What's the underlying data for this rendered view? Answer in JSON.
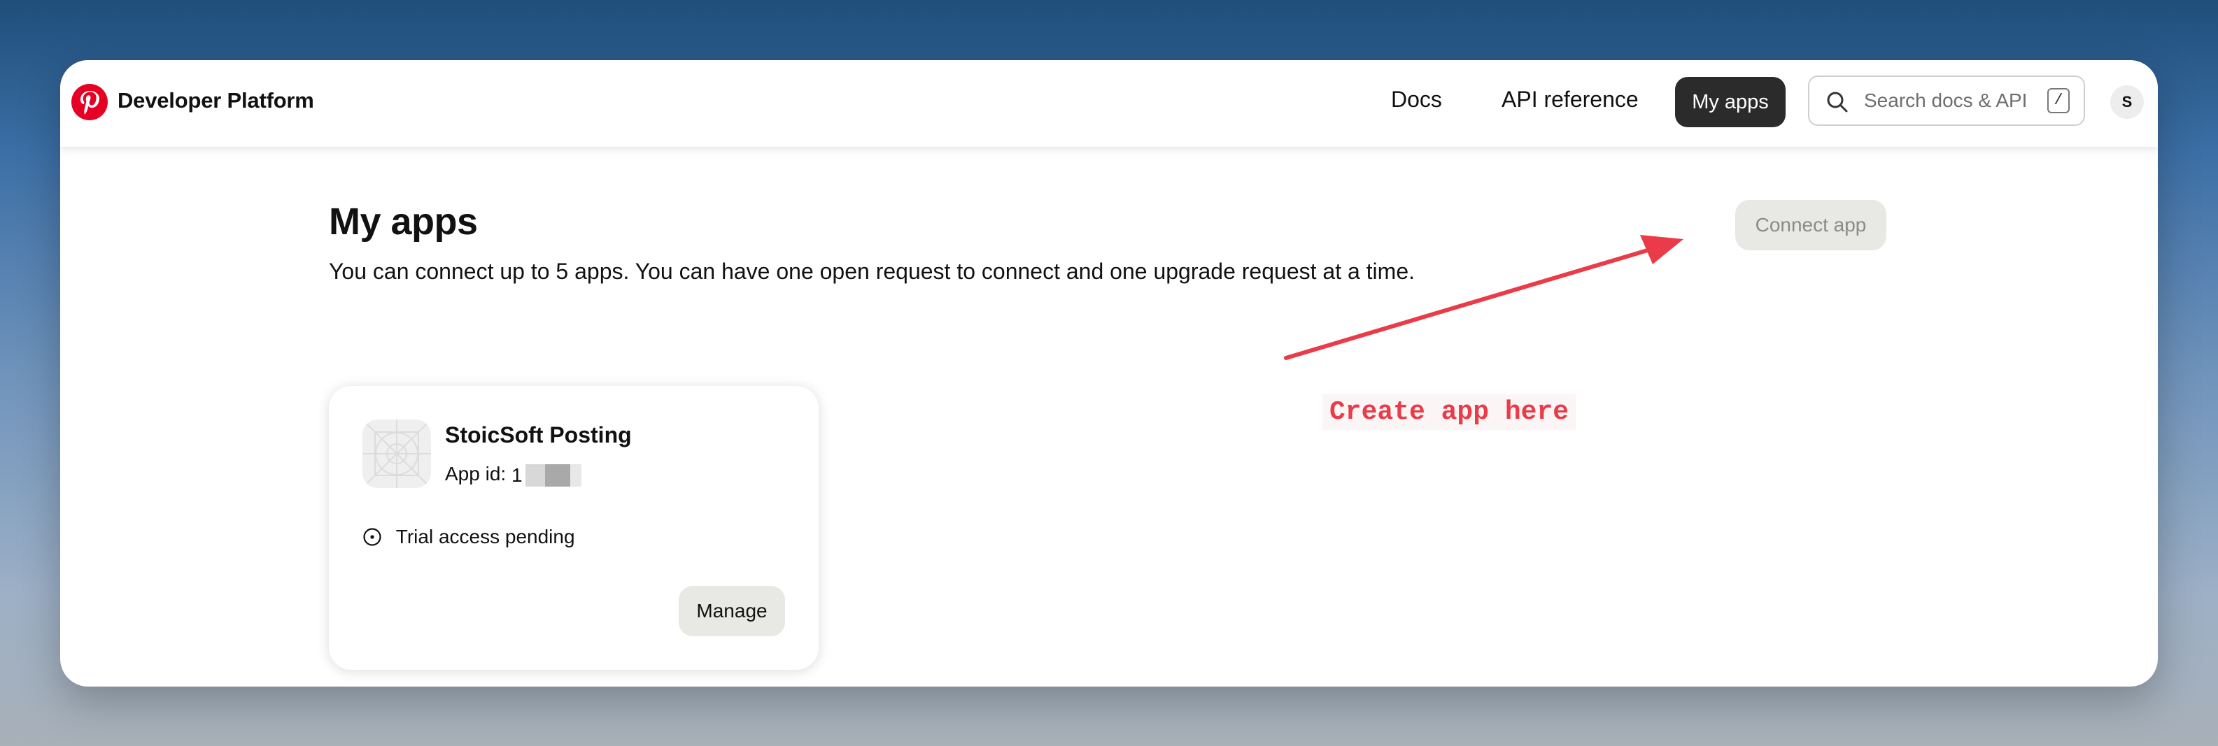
{
  "header": {
    "brand": "Developer Platform",
    "nav": {
      "docs": "Docs",
      "api_reference": "API reference",
      "my_apps": "My apps"
    },
    "search": {
      "placeholder": "Search docs & API",
      "shortcut": "/"
    },
    "avatar_initial": "S"
  },
  "main": {
    "title": "My apps",
    "description": "You can connect up to 5 apps. You can have one open request to connect and one upgrade request at a time.",
    "connect_button": "Connect app",
    "apps": [
      {
        "name": "StoicSoft Posting",
        "id_label": "App id:",
        "id_value_visible": "1",
        "status": "Trial access pending",
        "manage_label": "Manage"
      }
    ]
  },
  "annotation": {
    "text": "Create app here",
    "color": "#ea3b48"
  },
  "colors": {
    "brand_red": "#e60023",
    "active_nav_bg": "#2b2b2b",
    "secondary_button_bg": "#e8e8e4"
  },
  "icons": {
    "logo": "pinterest-logo",
    "search": "search-icon",
    "status": "clock-circle-icon",
    "app_placeholder": "app-placeholder-icon"
  }
}
